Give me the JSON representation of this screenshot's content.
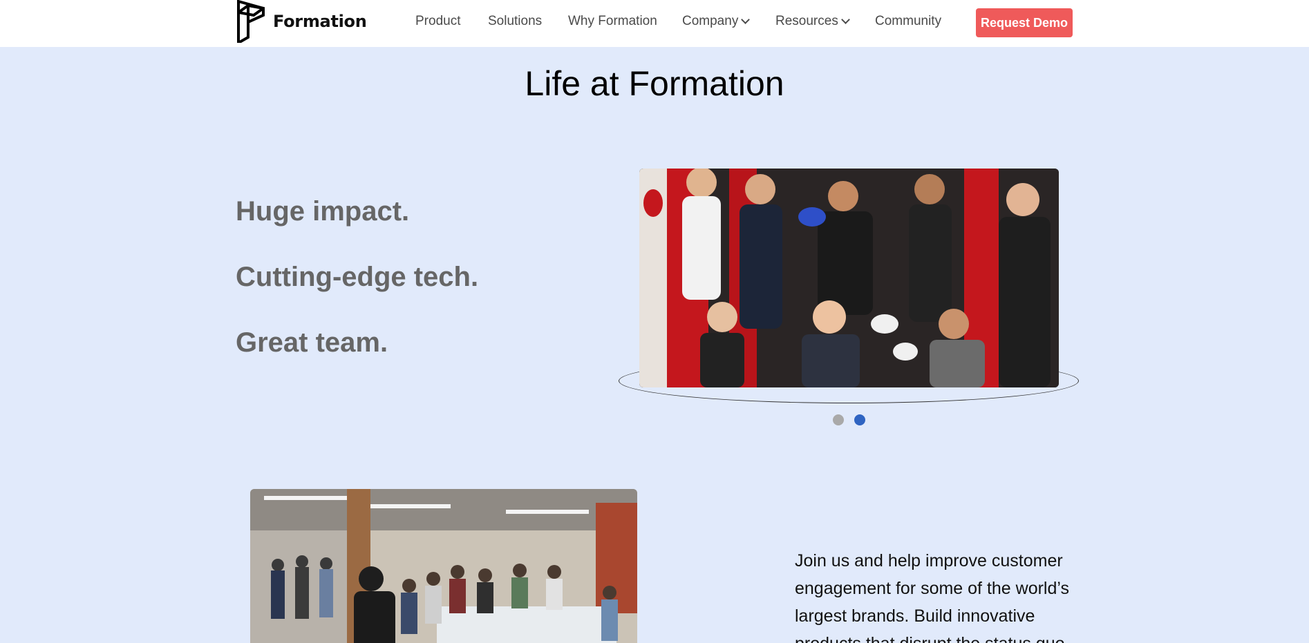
{
  "brand": {
    "name": "Formation",
    "logo_icon": "formation-logo-icon"
  },
  "nav": {
    "items": [
      {
        "label": "Product"
      },
      {
        "label": "Solutions"
      },
      {
        "label": "Why Formation"
      },
      {
        "label": "Company",
        "icon": "chevron-down-icon"
      },
      {
        "label": "Resources",
        "icon": "chevron-down-icon"
      },
      {
        "label": "Community"
      }
    ],
    "cta": "Request Demo"
  },
  "colors": {
    "background": "#e1eafb",
    "cta": "#ef5a5a",
    "tagline": "#666666",
    "dot_active": "#2f64c2",
    "dot_inactive": "#a9a9a9"
  },
  "hero": {
    "title": "Life at Formation",
    "taglines": [
      "Huge impact.",
      "Cutting-edge tech.",
      "Great team."
    ]
  },
  "carousel": {
    "slide_count": 2,
    "active_index": 1
  },
  "join": {
    "text": "Join us and help improve customer engagement for some of the world’s largest brands. Build innovative products that disrupt the status quo."
  }
}
